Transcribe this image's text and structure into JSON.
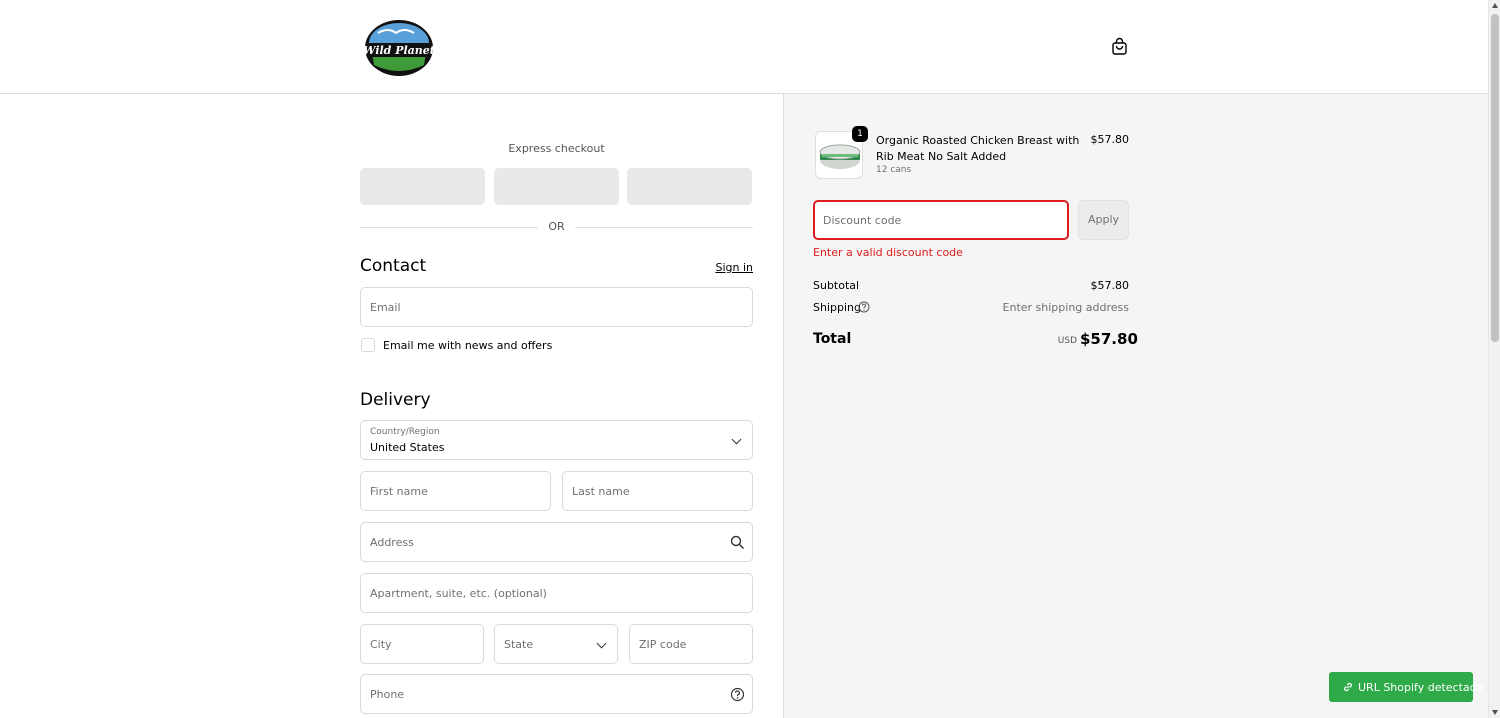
{
  "header": {
    "logo_text": "Wild Planet",
    "cart_icon": "shopping-bag-icon"
  },
  "express": {
    "label": "Express checkout",
    "or_label": "OR"
  },
  "contact": {
    "heading": "Contact",
    "signin_label": "Sign in",
    "email_placeholder": "Email",
    "newsletter_label": "Email me with news and offers"
  },
  "delivery": {
    "heading": "Delivery",
    "country_label": "Country/Region",
    "country_value": "United States",
    "first_name_placeholder": "First name",
    "last_name_placeholder": "Last name",
    "address_placeholder": "Address",
    "apartment_placeholder": "Apartment, suite, etc. (optional)",
    "city_placeholder": "City",
    "state_placeholder": "State",
    "zip_placeholder": "ZIP code",
    "phone_placeholder": "Phone"
  },
  "summary": {
    "product": {
      "name": "Organic Roasted Chicken Breast with Rib Meat No Salt Added",
      "variant": "12 cans",
      "price": "$57.80",
      "quantity": "1"
    },
    "discount_placeholder": "Discount code",
    "apply_label": "Apply",
    "discount_error": "Enter a valid discount code",
    "subtotal_label": "Subtotal",
    "subtotal_value": "$57.80",
    "shipping_label": "Shipping",
    "shipping_value": "Enter shipping address",
    "total_label": "Total",
    "total_currency": "USD",
    "total_value": "$57.80"
  },
  "extension": {
    "label": "URL Shopify detectada"
  },
  "colors": {
    "error": "#dd1d1d",
    "extension_green": "#2faa48",
    "summary_bg": "#f5f5f5"
  }
}
